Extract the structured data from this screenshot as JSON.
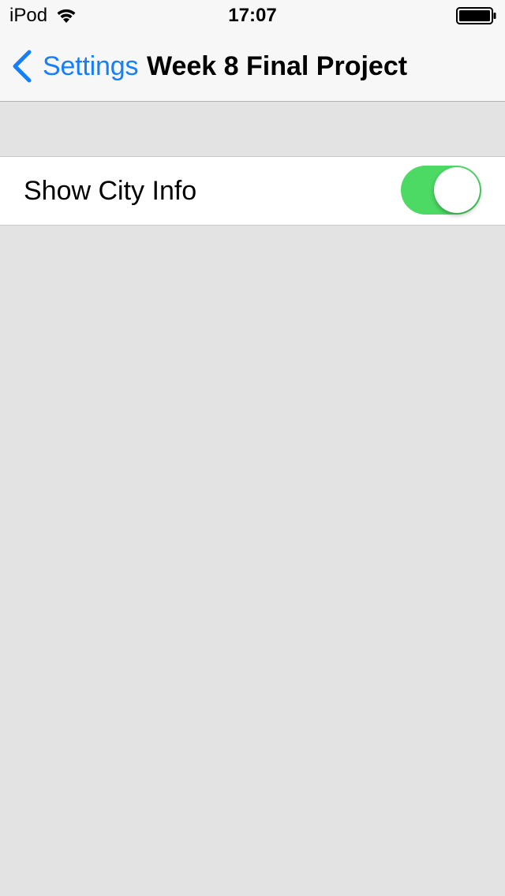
{
  "status_bar": {
    "carrier": "iPod",
    "time": "17:07"
  },
  "nav": {
    "back_label": "Settings",
    "title": "Week 8 Final Project"
  },
  "settings": {
    "rows": [
      {
        "label": "Show City Info",
        "toggle_on": true
      }
    ]
  },
  "colors": {
    "accent": "#157efb",
    "toggle_on": "#4cd964",
    "background": "#e3e3e3"
  }
}
